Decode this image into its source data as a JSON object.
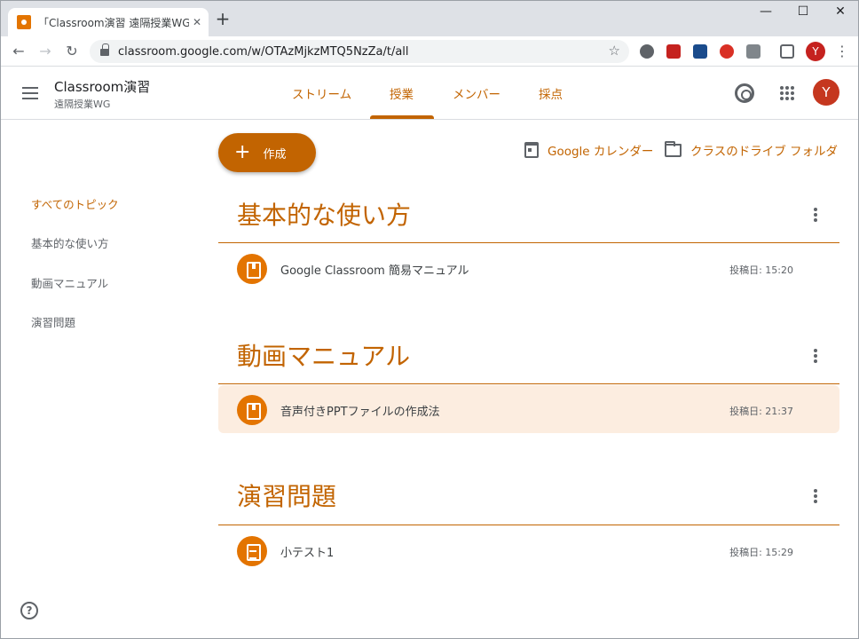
{
  "browser": {
    "tab_title": "「Classroom演習 遠隔授業WG」の",
    "tab_close": "✕",
    "new_tab": "+",
    "url": "classroom.google.com/w/OTAzMjkzMTQ5NzZa/t/all",
    "profile_initial": "Y",
    "window_controls": [
      "—",
      "☐",
      "✕"
    ]
  },
  "header": {
    "class_name": "Classroom演習",
    "section": "遠隔授業WG",
    "tabs": [
      "ストリーム",
      "授業",
      "メンバー",
      "採点"
    ],
    "active_tab": "授業",
    "avatar_initial": "Y"
  },
  "sidebar": {
    "items": [
      "すべてのトピック",
      "基本的な使い方",
      "動画マニュアル",
      "演習問題"
    ],
    "active": "すべてのトピック"
  },
  "toolbar": {
    "create_label": "作成",
    "calendar_label": "Google カレンダー",
    "drive_label": "クラスのドライブ フォルダ"
  },
  "topics": [
    {
      "title": "基本的な使い方",
      "items": [
        {
          "title": "Google Classroom 簡易マニュアル",
          "posted": "投稿日: 15:20",
          "icon": "material-icon"
        }
      ]
    },
    {
      "title": "動画マニュアル",
      "items": [
        {
          "title": "音声付きPPTファイルの作成法",
          "posted": "投稿日: 21:37",
          "icon": "material-icon"
        }
      ]
    },
    {
      "title": "演習問題",
      "items": [
        {
          "title": "小テスト1",
          "posted": "投稿日: 15:29",
          "icon": "assignment-icon"
        }
      ]
    }
  ],
  "colors": {
    "accent": "#c26401",
    "icon_bg": "#e37400",
    "highlight": "#fcede0"
  }
}
